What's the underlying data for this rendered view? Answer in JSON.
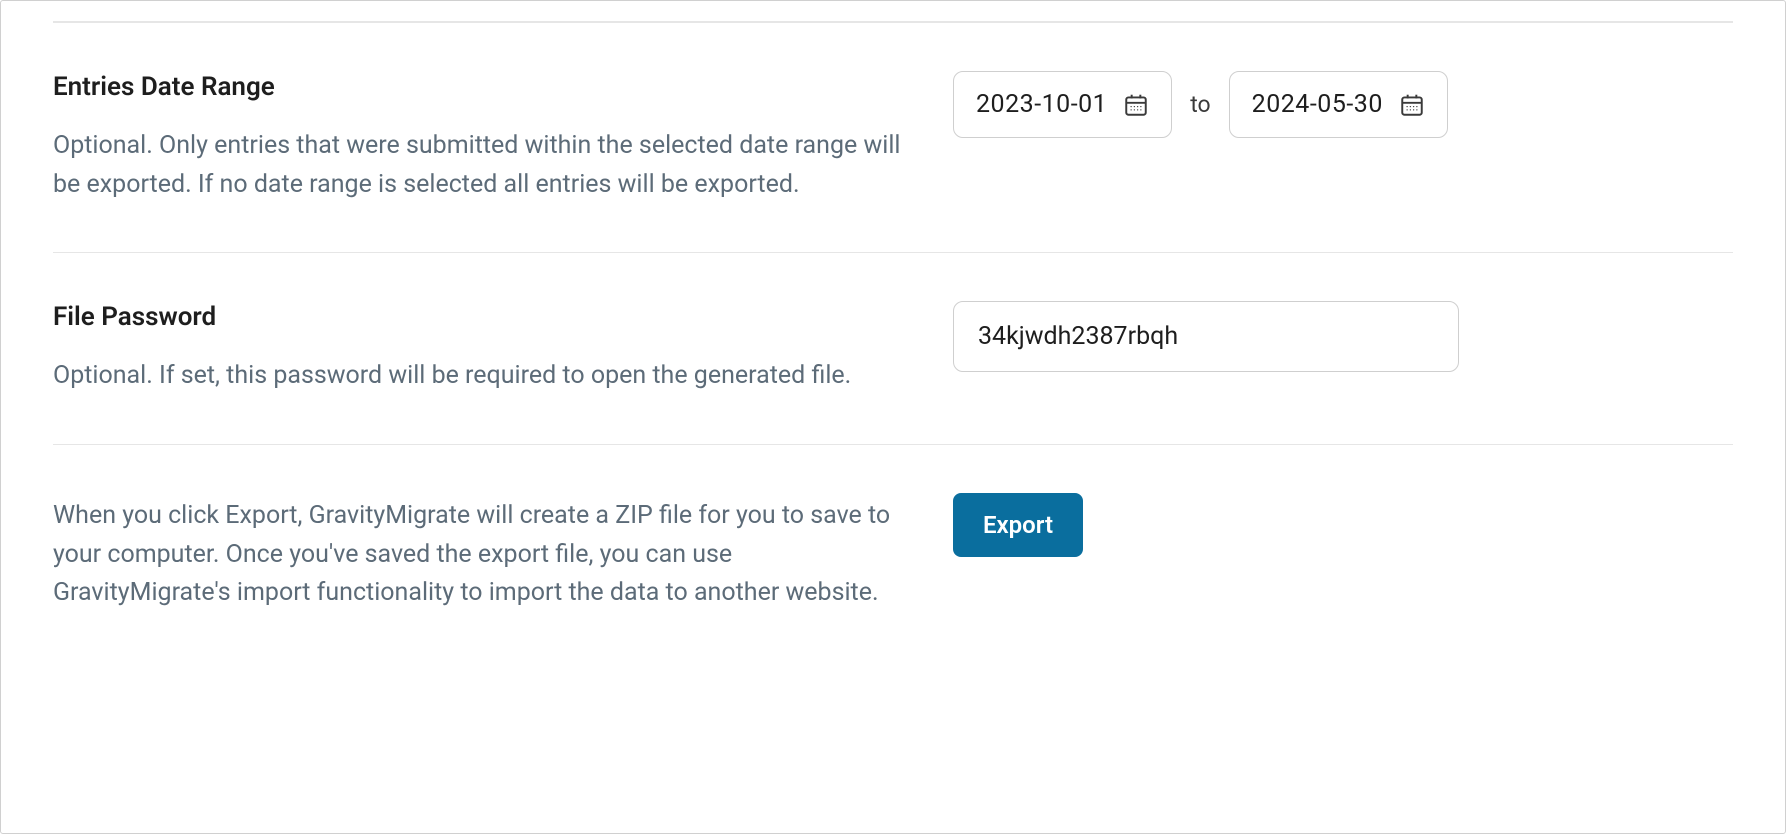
{
  "dateRange": {
    "title": "Entries Date Range",
    "description": "Optional. Only entries that were submitted within the selected date range will be exported. If no date range is selected all entries will be exported.",
    "from": "2023-10-01",
    "to": "2024-05-30",
    "separator": "to"
  },
  "password": {
    "title": "File Password",
    "description": "Optional. If set, this password will be required to open the generated file.",
    "value": "34kjwdh2387rbqh"
  },
  "export": {
    "description": "When you click Export, GravityMigrate will create a ZIP file for you to save to your computer. Once you've saved the export file, you can use GravityMigrate's import functionality to import the data to another website.",
    "buttonLabel": "Export"
  }
}
